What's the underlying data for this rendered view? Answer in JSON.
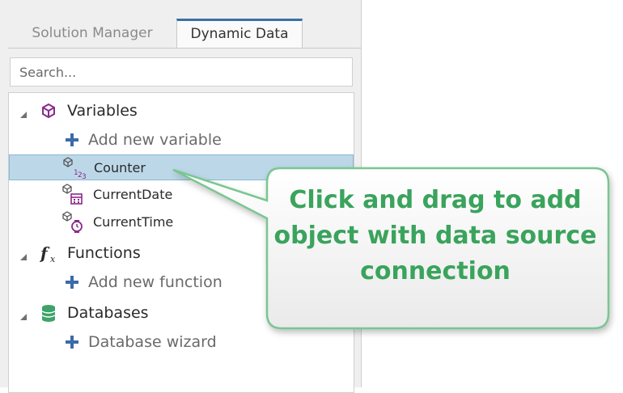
{
  "tabs": {
    "solution_manager": "Solution Manager",
    "dynamic_data": "Dynamic Data"
  },
  "search": {
    "placeholder": "Search..."
  },
  "tree": {
    "variables": {
      "label": "Variables",
      "add": "Add new variable",
      "items": [
        "Counter",
        "CurrentDate",
        "CurrentTime"
      ],
      "selected": "Counter",
      "counter_icon_text": "123"
    },
    "functions": {
      "label": "Functions",
      "add": "Add new function"
    },
    "databases": {
      "label": "Databases",
      "add": "Database wizard"
    }
  },
  "callout": {
    "line1": "Click and drag to add",
    "line2": "object with data source",
    "line3": "connection"
  },
  "colors": {
    "accent_tab": "#3b6ea8",
    "selection": "#bcd8e8",
    "callout_text": "#3aa35c",
    "callout_border": "#7ac690",
    "variable_icon": "#8a2a8a",
    "plus": "#3d6aa8",
    "database": "#3ea36b"
  }
}
